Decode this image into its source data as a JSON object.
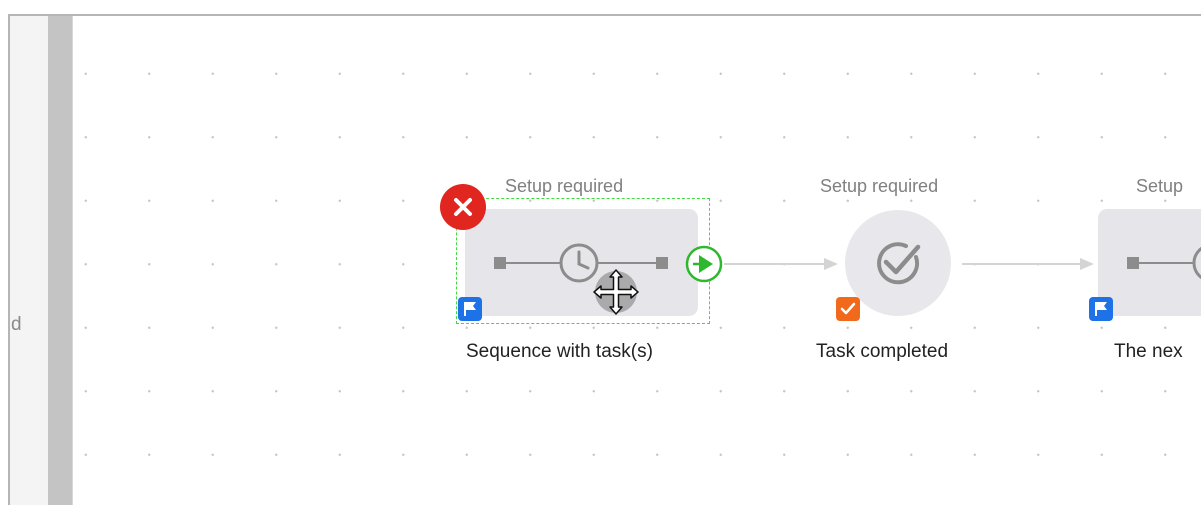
{
  "left_panel": {
    "text": "d"
  },
  "nodes": [
    {
      "top_label": "Setup required",
      "bottom_label": "Sequence with task(s)",
      "badge": "flag-icon",
      "selected": true,
      "error": true
    },
    {
      "top_label": "Setup required",
      "bottom_label": "Task completed",
      "badge": "checkmark-icon",
      "selected": false,
      "error": false
    },
    {
      "top_label": "Setup",
      "bottom_label": "The nex",
      "badge": "flag-icon",
      "selected": false,
      "error": false
    }
  ],
  "colors": {
    "selection": "#44d844",
    "error": "#e0261f",
    "flag_badge": "#1e72e8",
    "check_badge": "#f16a1c",
    "connector_handle": "#2eb82e"
  },
  "cursor": "move-cursor-icon"
}
